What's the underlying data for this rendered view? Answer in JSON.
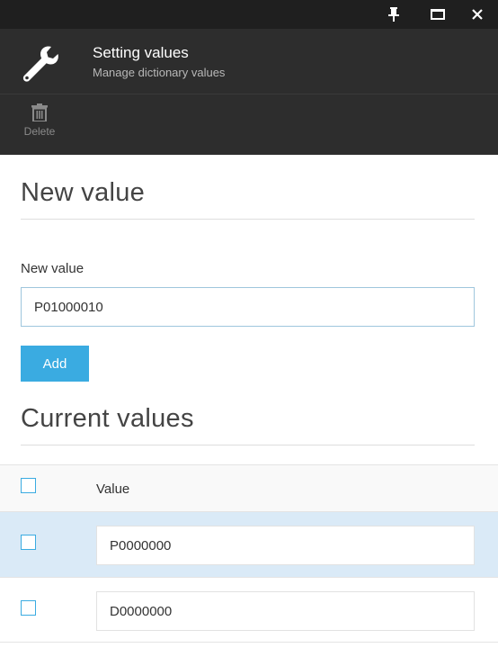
{
  "window": {
    "pin_icon": "pin-icon",
    "maximize_icon": "maximize-icon",
    "close_icon": "close-icon"
  },
  "header": {
    "icon": "wrench-icon",
    "title": "Setting values",
    "subtitle": "Manage dictionary values"
  },
  "toolbar": {
    "delete_icon": "trash-icon",
    "delete_label": "Delete"
  },
  "new_value_section": {
    "heading": "New value",
    "field_label": "New value",
    "field_value": "P01000010",
    "add_label": "Add"
  },
  "current_values_section": {
    "heading": "Current values",
    "column_header": "Value",
    "rows": [
      {
        "value": "P0000000",
        "selected": true
      },
      {
        "value": "D0000000",
        "selected": false
      }
    ]
  },
  "colors": {
    "accent": "#3aabe1",
    "header_bg": "#2d2d2d",
    "titlebar_bg": "#1f1f1f",
    "selected_row_bg": "#daeaf7"
  }
}
